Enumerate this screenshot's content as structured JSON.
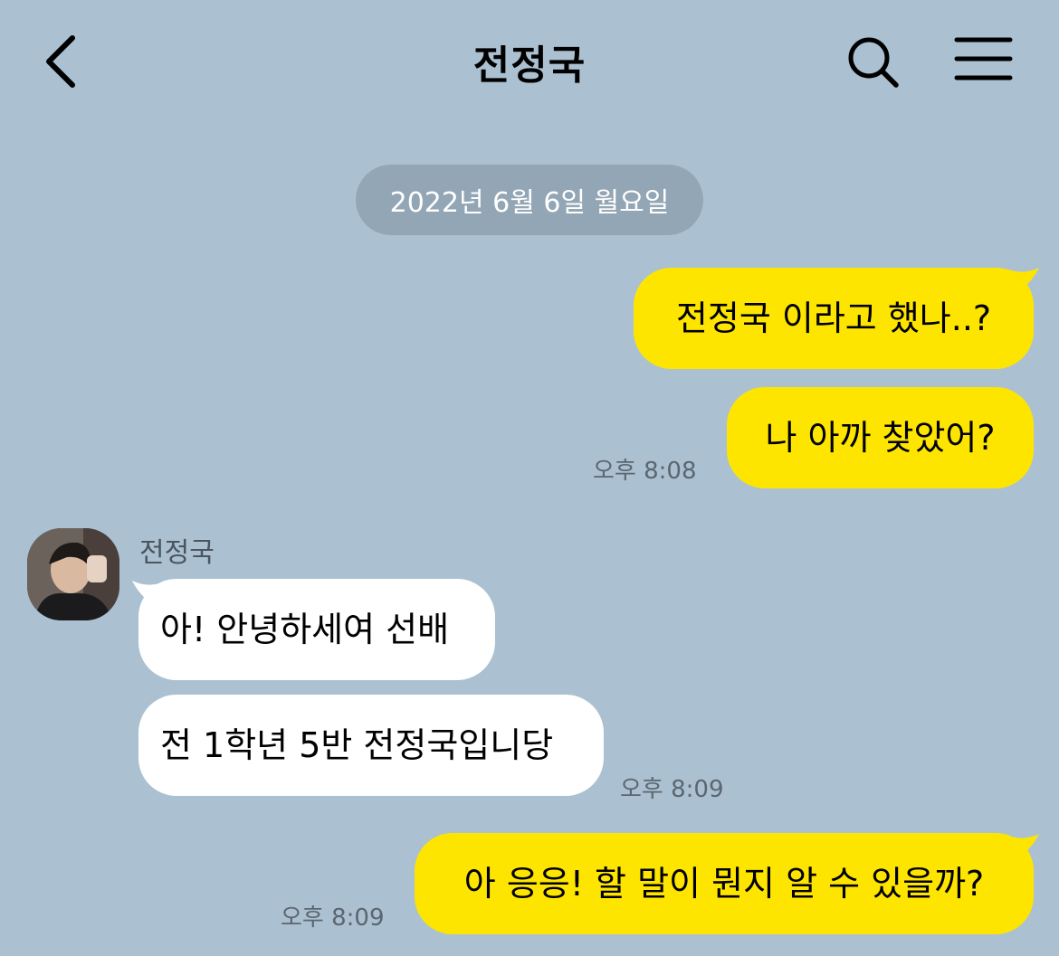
{
  "header": {
    "title": "전정국"
  },
  "date_divider": "2022년 6월 6일 월요일",
  "sender": {
    "name": "전정국"
  },
  "messages": [
    {
      "text": "전정국 이라고 했나..?",
      "from": "me"
    },
    {
      "text": "나 아까 찾았어?",
      "from": "me",
      "time": "오후 8:08"
    },
    {
      "text": "아! 안녕하세여 선배",
      "from": "them"
    },
    {
      "text": "전 1학년 5반 전정국입니당",
      "from": "them",
      "time": "오후 8:09"
    },
    {
      "text": "아 응응! 할 말이 뭔지 알 수 있을까?",
      "from": "me",
      "time": "오후 8:09"
    }
  ],
  "colors": {
    "background": "#abc1d1",
    "my_bubble": "#fee500",
    "their_bubble": "#ffffff",
    "date_pill": "#93a6b5"
  },
  "icons": [
    "chevron-left-icon",
    "search-icon",
    "hamburger-menu-icon"
  ]
}
